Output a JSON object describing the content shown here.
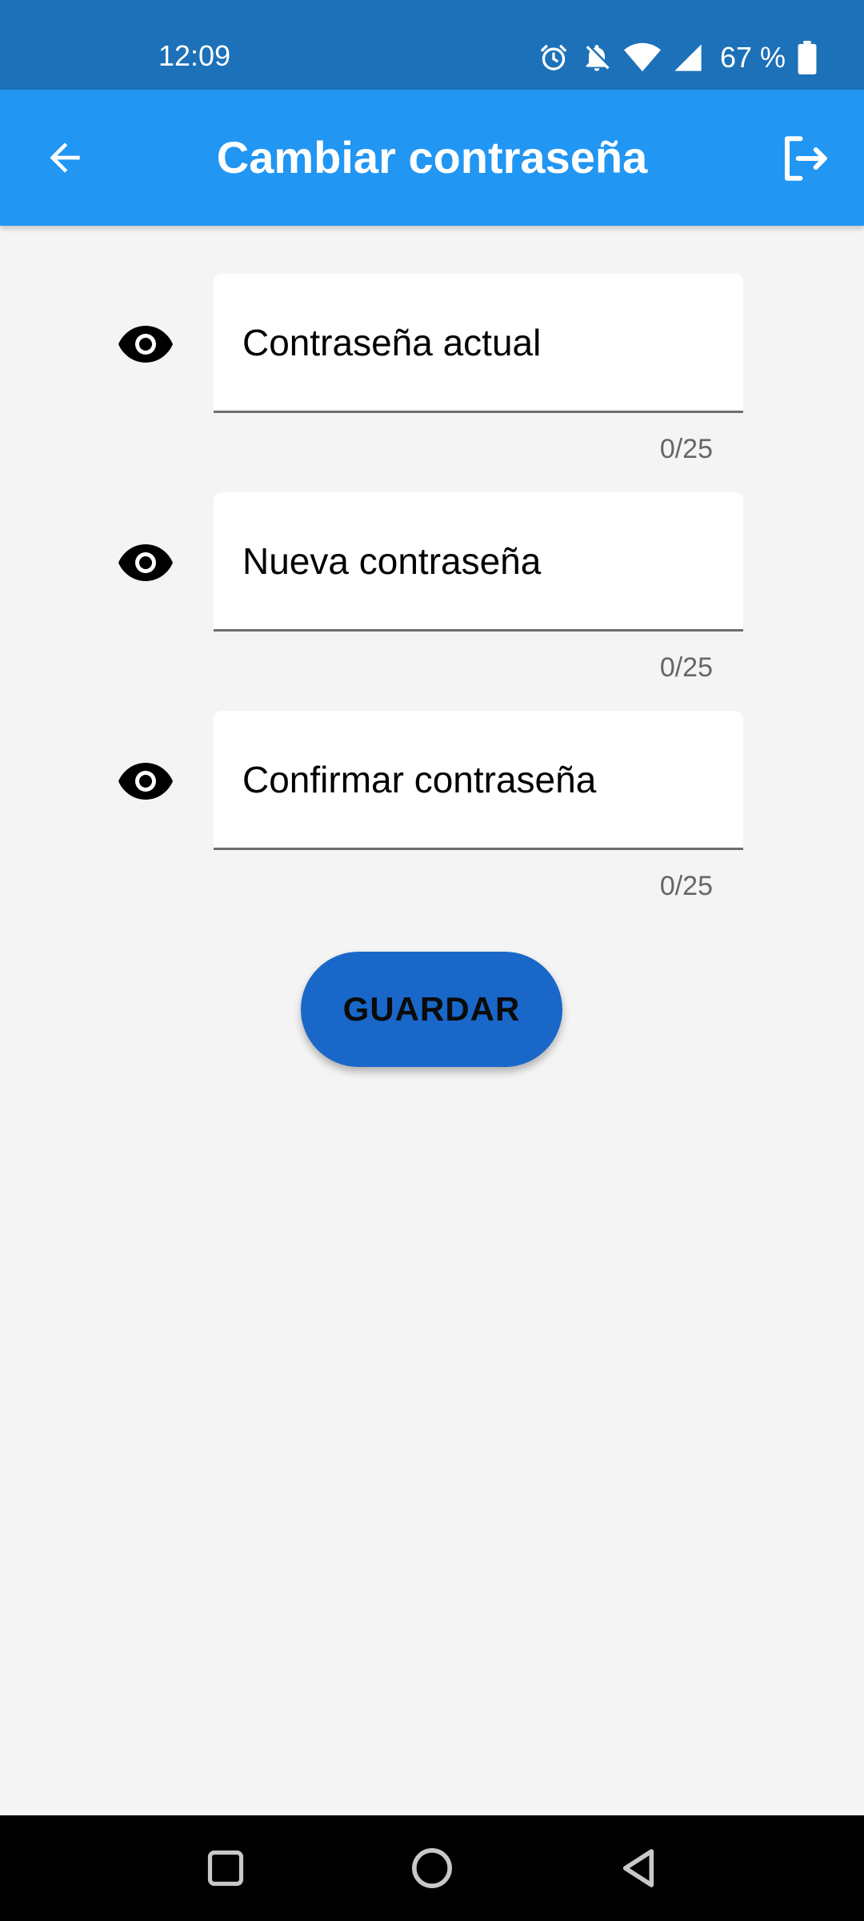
{
  "status_bar": {
    "time": "12:09",
    "battery": "67 %",
    "icons": [
      "alarm-icon",
      "notifications-off-icon",
      "wifi-icon",
      "signal-icon",
      "battery-icon"
    ]
  },
  "app_bar": {
    "title": "Cambiar contraseña",
    "back_icon": "arrow-back-icon",
    "logout_icon": "logout-icon",
    "background": "#2196f3"
  },
  "form": {
    "fields": [
      {
        "placeholder": "Contraseña actual",
        "value": "",
        "counter": "0/25",
        "toggle_icon": "eye-icon"
      },
      {
        "placeholder": "Nueva contraseña",
        "value": "",
        "counter": "0/25",
        "toggle_icon": "eye-icon"
      },
      {
        "placeholder": "Confirmar contraseña",
        "value": "",
        "counter": "0/25",
        "toggle_icon": "eye-icon"
      }
    ],
    "save_label": "GUARDAR",
    "save_color": "#1967c9"
  },
  "nav_bar": {
    "buttons": [
      "recents-square-icon",
      "home-circle-icon",
      "back-triangle-icon"
    ]
  }
}
